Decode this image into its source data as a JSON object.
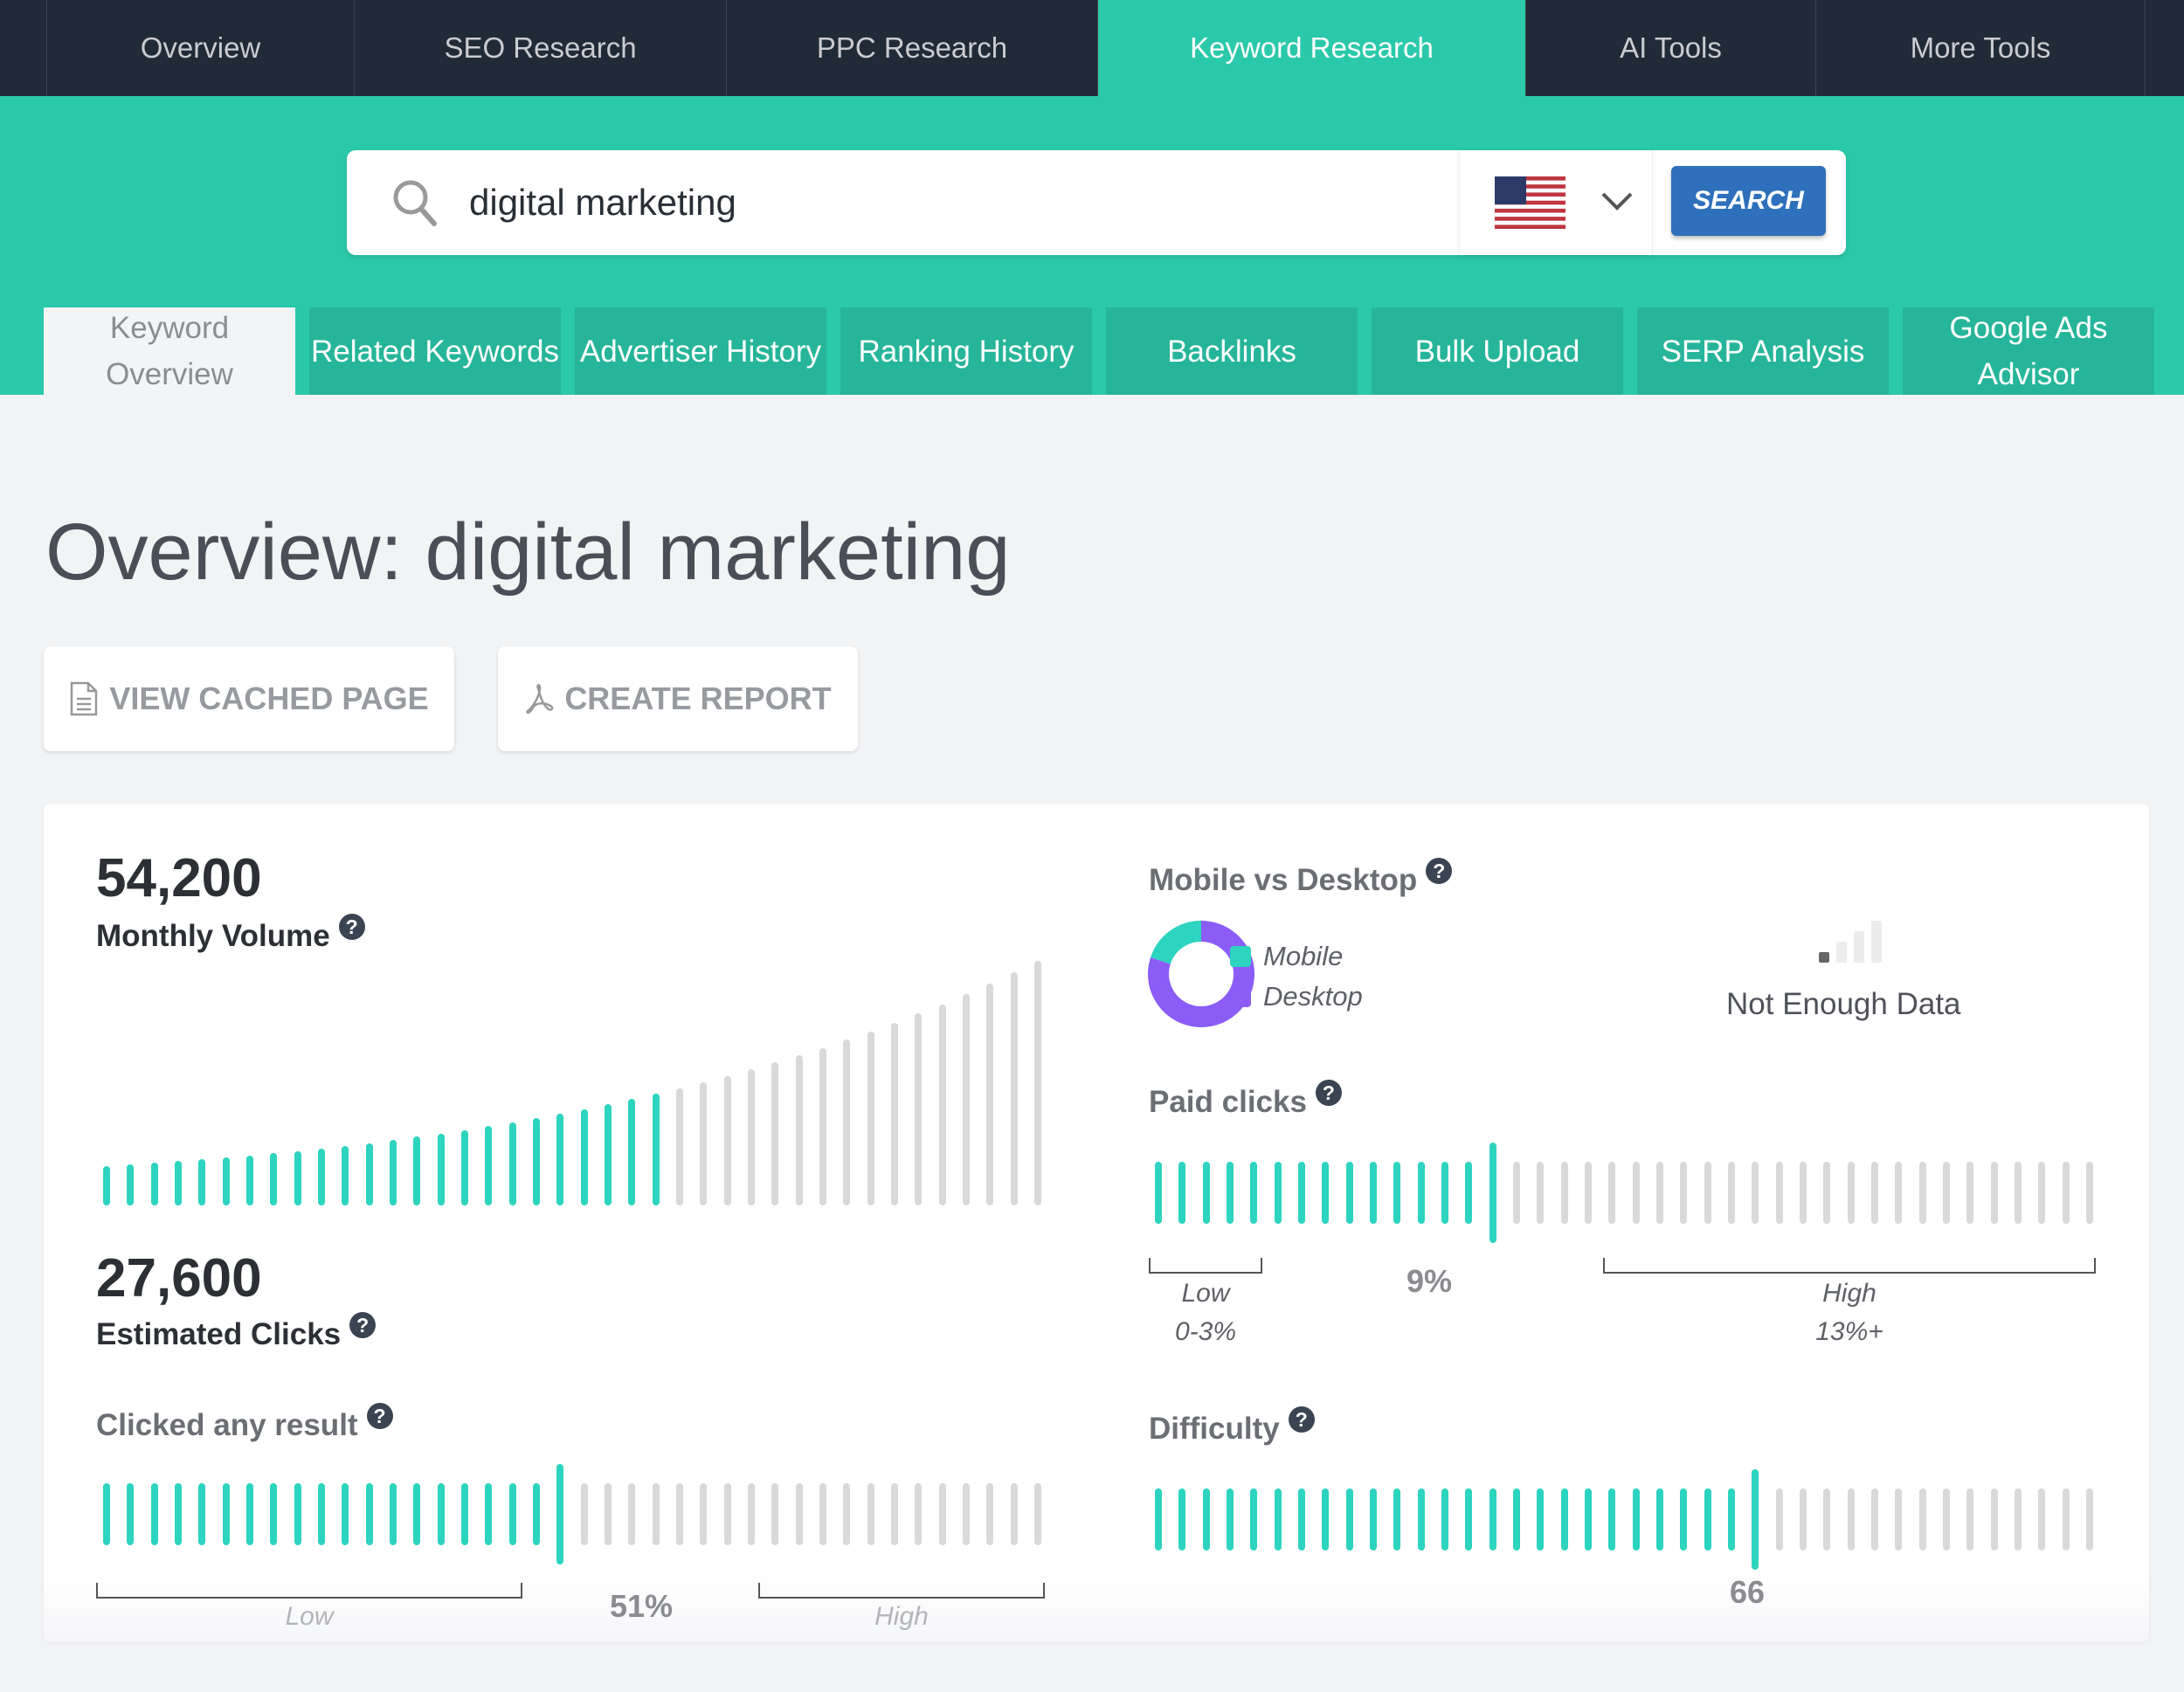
{
  "topnav": {
    "items": [
      {
        "label": "Overview",
        "active": false
      },
      {
        "label": "SEO Research",
        "active": false
      },
      {
        "label": "PPC Research",
        "active": false
      },
      {
        "label": "Keyword Research",
        "active": true
      },
      {
        "label": "AI Tools",
        "active": false
      },
      {
        "label": "More Tools",
        "active": false
      }
    ]
  },
  "search": {
    "value": "digital marketing",
    "country": "United States",
    "button_label": "SEARCH"
  },
  "subtabs": [
    {
      "label": "Keyword Overview",
      "active": true
    },
    {
      "label": "Related Keywords",
      "active": false
    },
    {
      "label": "Advertiser History",
      "active": false
    },
    {
      "label": "Ranking History",
      "active": false
    },
    {
      "label": "Backlinks",
      "active": false
    },
    {
      "label": "Bulk Upload",
      "active": false
    },
    {
      "label": "SERP Analysis",
      "active": false
    },
    {
      "label": "Google Ads Advisor",
      "active": false
    }
  ],
  "page": {
    "title": "Overview: digital marketing",
    "view_cached_label": "VIEW CACHED PAGE",
    "create_report_label": "CREATE REPORT"
  },
  "metrics": {
    "monthly_volume": {
      "value": "54,200",
      "label": "Monthly Volume"
    },
    "estimated_clicks": {
      "value": "27,600",
      "label": "Estimated Clicks"
    },
    "clicked_any_result": {
      "label": "Clicked any result",
      "value": "51%",
      "low_label": "Low",
      "high_label": "High"
    },
    "mobile_vs_desktop": {
      "label": "Mobile vs Desktop",
      "legend": [
        "Mobile",
        "Desktop"
      ],
      "status": "Not Enough Data"
    },
    "paid_clicks": {
      "label": "Paid clicks",
      "value": "9%",
      "low_label": "Low",
      "low_range": "0-3%",
      "high_label": "High",
      "high_range": "13%+"
    },
    "difficulty": {
      "label": "Difficulty",
      "value": "66"
    }
  },
  "colors": {
    "accent": "#2bc9ab",
    "bar_active": "#2dd4bf",
    "bar_inactive": "#d9d9d9",
    "nav_bg": "#212a37",
    "search_button": "#2e70bb",
    "mobile": "#2dd4bf",
    "desktop": "#8b5cf6"
  },
  "chart_data": [
    {
      "type": "bar",
      "title": "Monthly Volume",
      "bar_count": 40,
      "active_bars": 24,
      "values": [
        1,
        1.04,
        1.08,
        1.12,
        1.16,
        1.21,
        1.26,
        1.31,
        1.37,
        1.43,
        1.5,
        1.57,
        1.65,
        1.73,
        1.81,
        1.9,
        2,
        2.1,
        2.2,
        2.31,
        2.43,
        2.55,
        2.68,
        2.81,
        2.95,
        3.1,
        3.26,
        3.43,
        3.6,
        3.78,
        3.97,
        4.17,
        4.38,
        4.6,
        4.83,
        5.07,
        5.32,
        5.59,
        5.87,
        6.16
      ]
    },
    {
      "type": "gauge",
      "title": "Clicked any result",
      "value_pct": 51,
      "bar_count": 40,
      "marker_index": 19
    },
    {
      "type": "pie",
      "title": "Mobile vs Desktop",
      "categories": [
        "Mobile",
        "Desktop"
      ],
      "values": [
        20,
        80
      ]
    },
    {
      "type": "gauge",
      "title": "Paid clicks",
      "value_pct": 9,
      "bar_count": 40,
      "marker_index": 14
    },
    {
      "type": "gauge",
      "title": "Difficulty",
      "value": 66,
      "bar_count": 40,
      "marker_index": 25
    }
  ]
}
